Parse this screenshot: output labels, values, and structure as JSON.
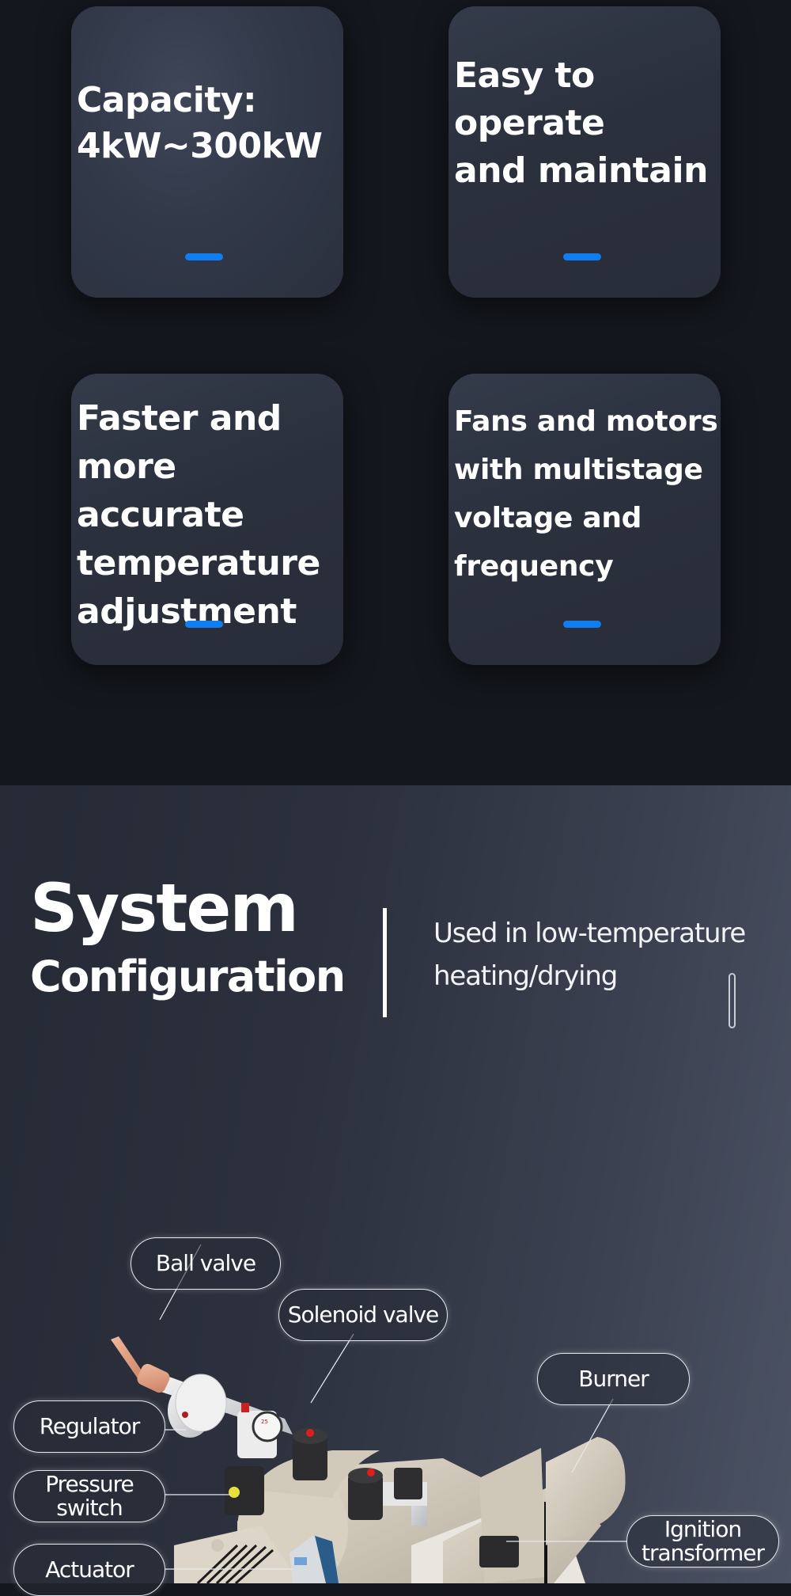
{
  "features": {
    "cards": [
      {
        "text": "Capacity:\n4kW~300kW"
      },
      {
        "text": "Easy to\noperate\nand maintain"
      },
      {
        "text": "Faster and\nmore accurate\ntemperature\nadjustment"
      },
      {
        "text": "Fans and motors\nwith multistage\nvoltage and\nfrequency"
      }
    ],
    "accent_color": "#0f7ef0"
  },
  "config": {
    "title_line1": "System",
    "title_line2": "Configuration",
    "subtitle": "Used in low-temperature\nheating/drying"
  },
  "diagram": {
    "labels": {
      "ball_valve": "Ball valve",
      "solenoid_valve": "Solenoid valve",
      "burner": "Burner",
      "regulator": "Regulator",
      "pressure_switch": "Pressure\nswitch",
      "actuator": "Actuator",
      "ignition_transformer": "Ignition\ntransformer"
    }
  }
}
